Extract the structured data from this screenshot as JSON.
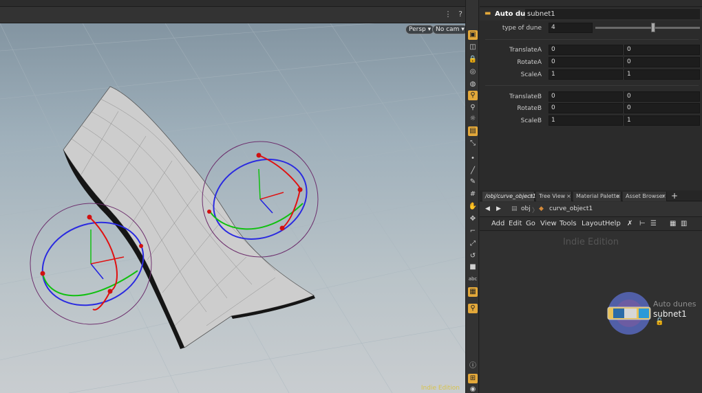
{
  "viewport": {
    "persp_button": "Persp",
    "cam_button": "No cam",
    "watermark": "Indie Edition"
  },
  "params": {
    "node_type": "Auto dunes",
    "node_name": "subnet1",
    "type_of_dune": {
      "label": "type of dune",
      "value": "4",
      "slider_fraction": 0.55
    },
    "group_a": [
      {
        "label": "TranslateA",
        "v1": "0",
        "v2": "0"
      },
      {
        "label": "RotateA",
        "v1": "0",
        "v2": "0"
      },
      {
        "label": "ScaleA",
        "v1": "1",
        "v2": "1"
      }
    ],
    "group_b": [
      {
        "label": "TranslateB",
        "v1": "0",
        "v2": "0"
      },
      {
        "label": "RotateB",
        "v1": "0",
        "v2": "0"
      },
      {
        "label": "ScaleB",
        "v1": "1",
        "v2": "1"
      }
    ]
  },
  "network": {
    "tabs": [
      "/obj/curve_object1",
      "Tree View",
      "Material Palette",
      "Asset Browser"
    ],
    "path": [
      "obj",
      "curve_object1"
    ],
    "menu": [
      "Add",
      "Edit",
      "Go",
      "View",
      "Tools",
      "Layout",
      "Help"
    ],
    "watermark": "Indie Edition",
    "node_type_label": "Auto dunes",
    "node_name_label": "subnet1"
  },
  "colors": {
    "accent": "#e3a83a",
    "node_ring": "#5c6fcf",
    "node_body": "#e8c25a"
  }
}
